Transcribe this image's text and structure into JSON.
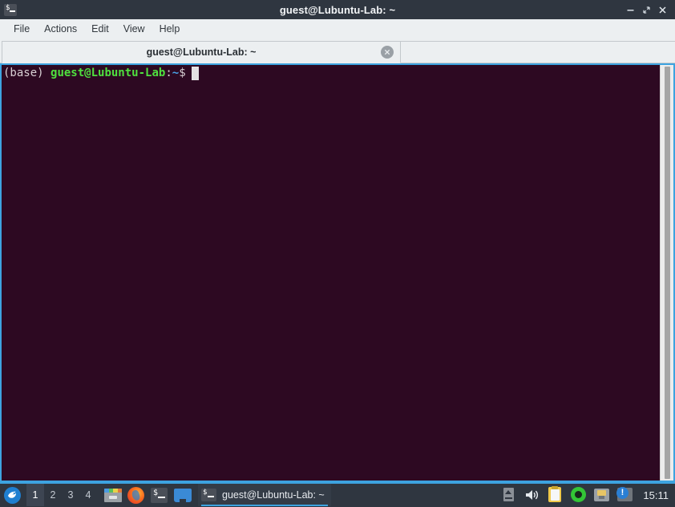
{
  "window": {
    "title": "guest@Lubuntu-Lab: ~",
    "icon": "terminal-icon",
    "controls": {
      "minimize": "minimize-icon",
      "maximize": "maximize-icon",
      "close": "close-icon"
    }
  },
  "menubar": {
    "items": [
      {
        "label": "File"
      },
      {
        "label": "Actions"
      },
      {
        "label": "Edit"
      },
      {
        "label": "View"
      },
      {
        "label": "Help"
      }
    ]
  },
  "tabs": [
    {
      "label": "guest@Lubuntu-Lab: ~",
      "close_icon": "close-circle-icon",
      "active": true
    }
  ],
  "terminal": {
    "prompt": {
      "env": "(base) ",
      "user_host": "guest@Lubuntu-Lab",
      "colon": ":",
      "path": "~",
      "sigil": "$"
    },
    "colors": {
      "background": "#2d0922",
      "foreground": "#d8d0d4",
      "user_host": "#4fe03f",
      "path": "#4aa3e8",
      "cursor": "#e4e1e2",
      "border": "#3da3e0"
    },
    "command_line": ""
  },
  "taskbar": {
    "start": {
      "name": "Lubuntu menu",
      "icon": "lubuntu-logo-icon"
    },
    "workspaces": [
      {
        "label": "1",
        "active": true
      },
      {
        "label": "2",
        "active": false
      },
      {
        "label": "3",
        "active": false
      },
      {
        "label": "4",
        "active": false
      }
    ],
    "launchers": [
      {
        "icon": "file-manager-icon"
      },
      {
        "icon": "firefox-icon"
      },
      {
        "icon": "terminal-icon"
      },
      {
        "icon": "blue-app-icon"
      }
    ],
    "windows": [
      {
        "label": "guest@Lubuntu-Lab: ~",
        "icon": "terminal-icon",
        "active": true
      }
    ],
    "tray": [
      {
        "icon": "eject-media-icon"
      },
      {
        "icon": "volume-icon"
      },
      {
        "icon": "clipboard-icon"
      },
      {
        "icon": "green-status-icon"
      },
      {
        "icon": "network-icon"
      },
      {
        "icon": "update-notifier-icon"
      }
    ],
    "clock": "15:11",
    "accent": "#3da3e0"
  }
}
